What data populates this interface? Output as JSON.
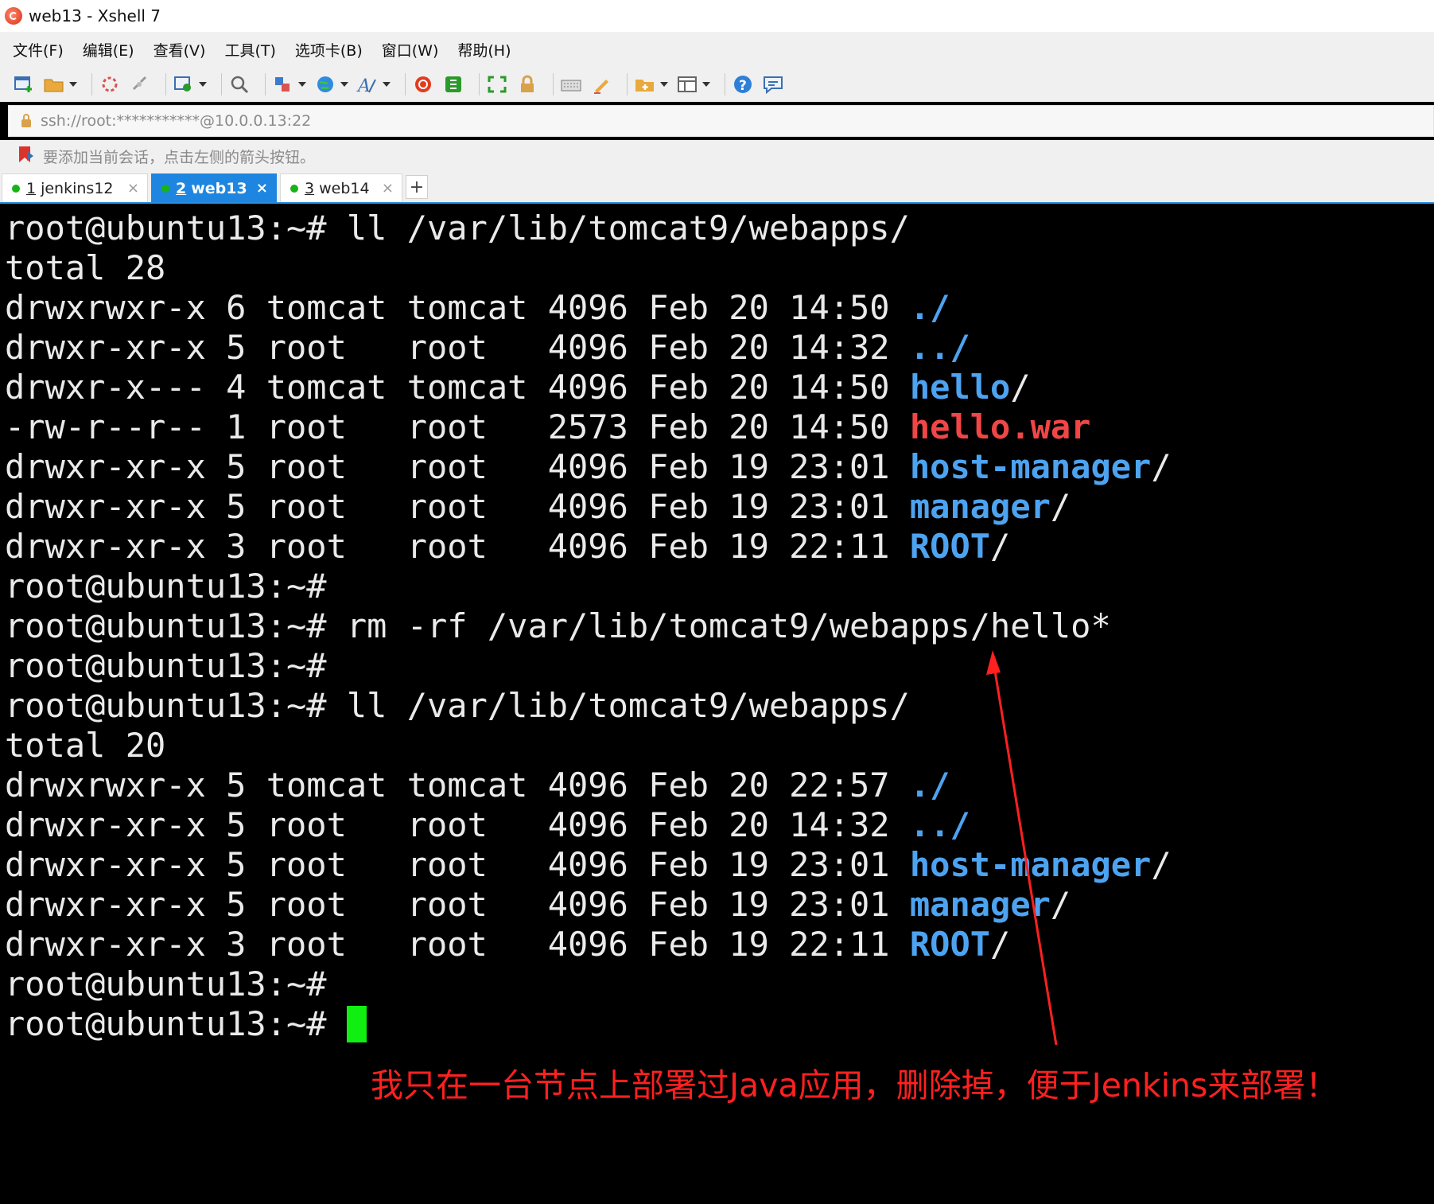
{
  "window": {
    "title": "web13 - Xshell 7"
  },
  "menu": [
    {
      "label": "文件(F)"
    },
    {
      "label": "编辑(E)"
    },
    {
      "label": "查看(V)"
    },
    {
      "label": "工具(T)"
    },
    {
      "label": "选项卡(B)"
    },
    {
      "label": "窗口(W)"
    },
    {
      "label": "帮助(H)"
    }
  ],
  "toolbar_icons": [
    "new-session-icon",
    "open-folder-icon",
    "reconnect-icon",
    "disconnect-icon",
    "properties-icon",
    "find-icon",
    "transfer-icon",
    "globe-icon",
    "font-icon",
    "xshell-icon",
    "xftp-icon",
    "fullscreen-icon",
    "lock-icon",
    "keyboard-icon",
    "highlight-icon",
    "compose-icon",
    "layout-icon",
    "help-icon",
    "chat-icon"
  ],
  "address": {
    "value": "ssh://root:***********@10.0.0.13:22"
  },
  "hint": {
    "text": "要添加当前会话，点击左侧的箭头按钮。"
  },
  "tabs": [
    {
      "num": "1",
      "name": "jenkins12",
      "active": false
    },
    {
      "num": "2",
      "name": "web13",
      "active": true
    },
    {
      "num": "3",
      "name": "web14",
      "active": false
    }
  ],
  "tab_add_label": "+",
  "tab_close_label": "×",
  "terminal": {
    "prompt": "root@ubuntu13:~#",
    "cmd1": " ll /var/lib/tomcat9/webapps/",
    "total1": "total 28",
    "listing1": [
      {
        "meta": "drwxrwxr-x 6 tomcat tomcat 4096 Feb 20 14:50 ",
        "name": "./",
        "kind": "plain"
      },
      {
        "meta": "drwxr-xr-x 5 root   root   4096 Feb 20 14:32 ",
        "name": "../",
        "kind": "plain"
      },
      {
        "meta": "drwxr-x--- 4 tomcat tomcat 4096 Feb 20 14:50 ",
        "name": "hello",
        "kind": "dir",
        "suffix": "/"
      },
      {
        "meta": "-rw-r--r-- 1 root   root   2573 Feb 20 14:50 ",
        "name": "hello.war",
        "kind": "war"
      },
      {
        "meta": "drwxr-xr-x 5 root   root   4096 Feb 19 23:01 ",
        "name": "host-manager",
        "kind": "dir",
        "suffix": "/"
      },
      {
        "meta": "drwxr-xr-x 5 root   root   4096 Feb 19 23:01 ",
        "name": "manager",
        "kind": "dir",
        "suffix": "/"
      },
      {
        "meta": "drwxr-xr-x 3 root   root   4096 Feb 19 22:11 ",
        "name": "ROOT",
        "kind": "dir",
        "suffix": "/"
      }
    ],
    "cmd2": " rm -rf /var/lib/tomcat9/webapps/hello*",
    "cmd3": " ll /var/lib/tomcat9/webapps/",
    "total2": "total 20",
    "listing2": [
      {
        "meta": "drwxrwxr-x 5 tomcat tomcat 4096 Feb 20 22:57 ",
        "name": "./",
        "kind": "plain"
      },
      {
        "meta": "drwxr-xr-x 5 root   root   4096 Feb 20 14:32 ",
        "name": "../",
        "kind": "plain"
      },
      {
        "meta": "drwxr-xr-x 5 root   root   4096 Feb 19 23:01 ",
        "name": "host-manager",
        "kind": "dir",
        "suffix": "/"
      },
      {
        "meta": "drwxr-xr-x 5 root   root   4096 Feb 19 23:01 ",
        "name": "manager",
        "kind": "dir",
        "suffix": "/"
      },
      {
        "meta": "drwxr-xr-x 3 root   root   4096 Feb 19 22:11 ",
        "name": "ROOT",
        "kind": "dir",
        "suffix": "/"
      }
    ]
  },
  "annotation": {
    "text": "我只在一台节点上部署过Java应用，删除掉，便于Jenkins来部署！",
    "color": "#ff2020"
  },
  "colors": {
    "dir": "#4da3f0",
    "war": "#f04646",
    "cursor": "#11ee11",
    "tab_active": "#1e86e0"
  }
}
